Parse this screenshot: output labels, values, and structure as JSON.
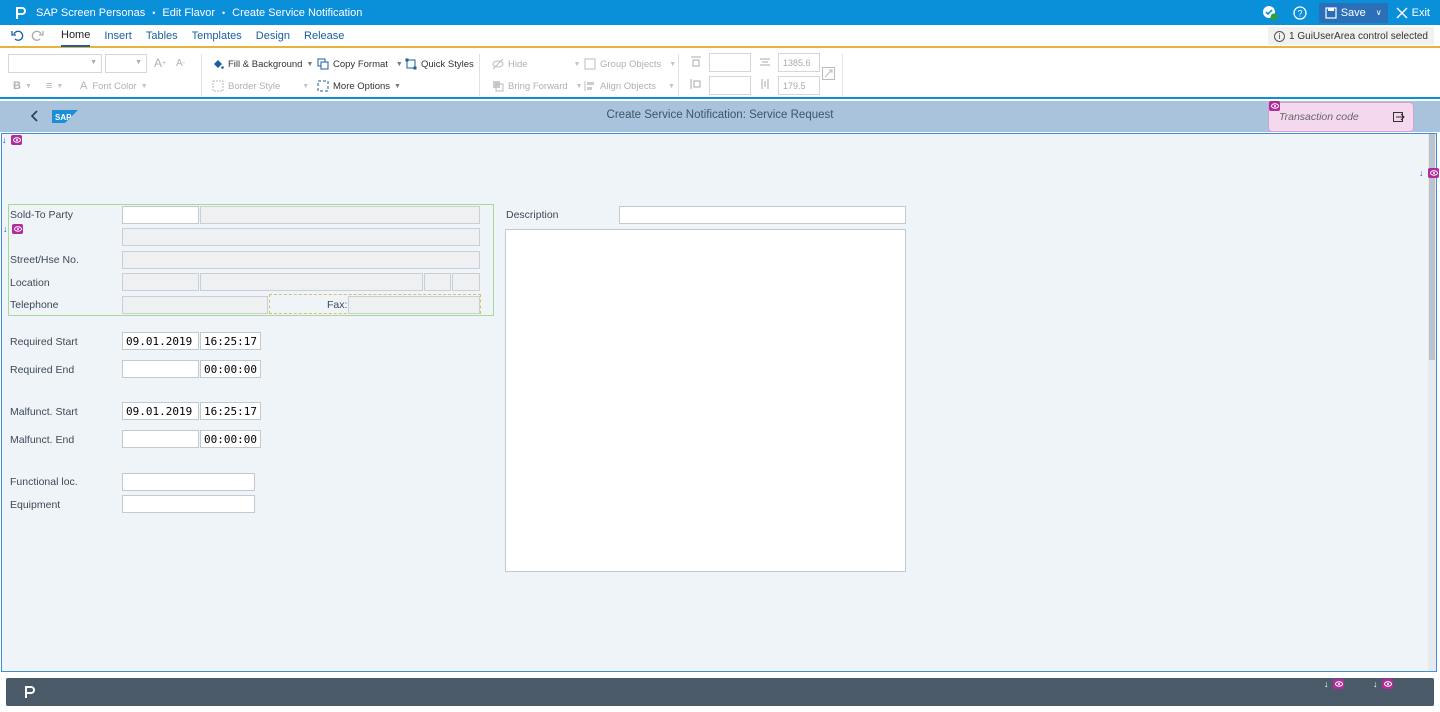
{
  "titlebar": {
    "app_name": "SAP Screen Personas",
    "crumb_1": "Edit Flavor",
    "crumb_2": "Create Service Notification",
    "separator": "•",
    "save_label": "Save",
    "exit_label": "Exit"
  },
  "menu": {
    "tabs": [
      {
        "label": "Home"
      },
      {
        "label": "Insert"
      },
      {
        "label": "Tables"
      },
      {
        "label": "Templates"
      },
      {
        "label": "Design"
      },
      {
        "label": "Release"
      }
    ],
    "active_tab": "Home",
    "selection_info": "1 GuiUserArea control selected"
  },
  "ribbon": {
    "font_color": "Font Color",
    "fill_background": "Fill & Background",
    "border_style": "Border Style",
    "copy_format": "Copy Format",
    "more_options": "More Options",
    "quick_styles": "Quick Styles",
    "hide": "Hide",
    "bring_forward": "Bring Forward",
    "group_objects": "Group Objects",
    "align_objects": "Align Objects",
    "width_value": "1385.6",
    "height_value": "179.5"
  },
  "screen": {
    "title": "Create Service Notification: Service Request",
    "transaction_code_placeholder": "Transaction code"
  },
  "form": {
    "sold_to_party_label": "Sold-To Party",
    "street_label": "Street/Hse No.",
    "location_label": "Location",
    "telephone_label": "Telephone",
    "fax_label": "Fax:",
    "required_start_label": "Required Start",
    "required_start_date": "09.01.2019",
    "required_start_time": "16:25:17",
    "required_end_label": "Required End",
    "required_end_date": "",
    "required_end_time": "00:00:00",
    "malfunct_start_label": "Malfunct. Start",
    "malfunct_start_date": "09.01.2019",
    "malfunct_start_time": "16:25:17",
    "malfunct_end_label": "Malfunct. End",
    "malfunct_end_date": "",
    "malfunct_end_time": "00:00:00",
    "functional_loc_label": "Functional loc.",
    "equipment_label": "Equipment",
    "description_label": "Description"
  },
  "colors": {
    "titlebar": "#0a8fd9",
    "ribbon_accent": "#e6b43c",
    "sap_header": "#a9c3dd",
    "footer": "#4a5a69",
    "marker": "#b12b9a"
  }
}
